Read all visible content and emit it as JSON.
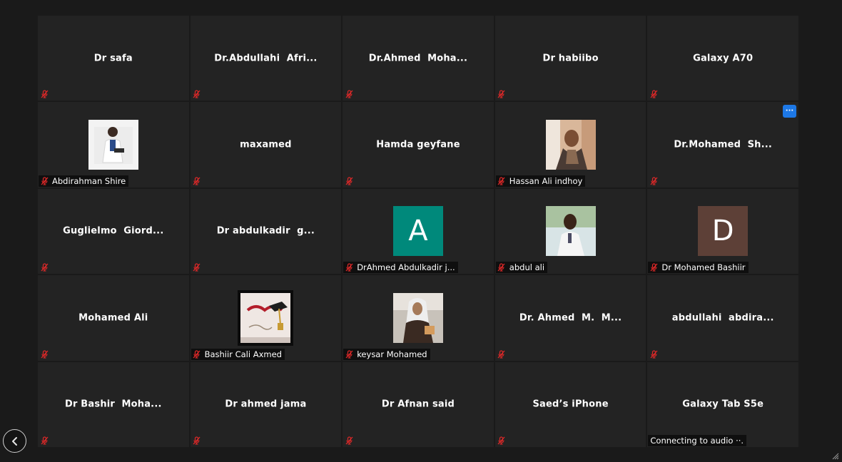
{
  "colors": {
    "tile_bg": "#232323",
    "page_bg": "#1a1a1a",
    "muted_red": "#e02828",
    "accent_blue": "#1d78e6",
    "avatar_teal": "#00897b",
    "avatar_brown": "#5d4037"
  },
  "participants": [
    {
      "name": "Dr safa"
    },
    {
      "name": "Dr.Abdullahi  Afri..."
    },
    {
      "name": "Dr.Ahmed  Moha..."
    },
    {
      "name": "Dr habiibo"
    },
    {
      "name": "Galaxy A70"
    },
    {
      "label": "Abdirahman Shire",
      "avatar": "photo-doctor"
    },
    {
      "name": "maxamed"
    },
    {
      "name": "Hamda geyfane"
    },
    {
      "label": "Hassan Ali indhoy",
      "avatar": "photo-man-scarf"
    },
    {
      "name": "Dr.Mohamed  Sh...",
      "more": "···"
    },
    {
      "name": "Guglielmo  Giord..."
    },
    {
      "name": "Dr abdulkadir  g..."
    },
    {
      "label": "DrAhmed Abdulkadir j...",
      "letter": "A",
      "letter_color": "#00897b"
    },
    {
      "label": "abdul ali",
      "avatar": "photo-man-white"
    },
    {
      "label": "Dr Mohamed Bashiir",
      "letter": "D",
      "letter_color": "#5d4037"
    },
    {
      "name": "Mohamed Ali"
    },
    {
      "label": "Bashiir Cali Axmed",
      "avatar": "photo-graduation-card"
    },
    {
      "label": "keysar Mohamed",
      "avatar": "photo-woman-hijab"
    },
    {
      "name": "Dr. Ahmed  M.  M..."
    },
    {
      "name": "abdullahi  abdira..."
    },
    {
      "name": "Dr Bashir  Moha..."
    },
    {
      "name": "Dr ahmed jama"
    },
    {
      "name": "Dr Afnan said"
    },
    {
      "name": "Saed’s iPhone"
    },
    {
      "name": "Galaxy Tab S5e",
      "status": "Connecting to audio ··."
    }
  ]
}
